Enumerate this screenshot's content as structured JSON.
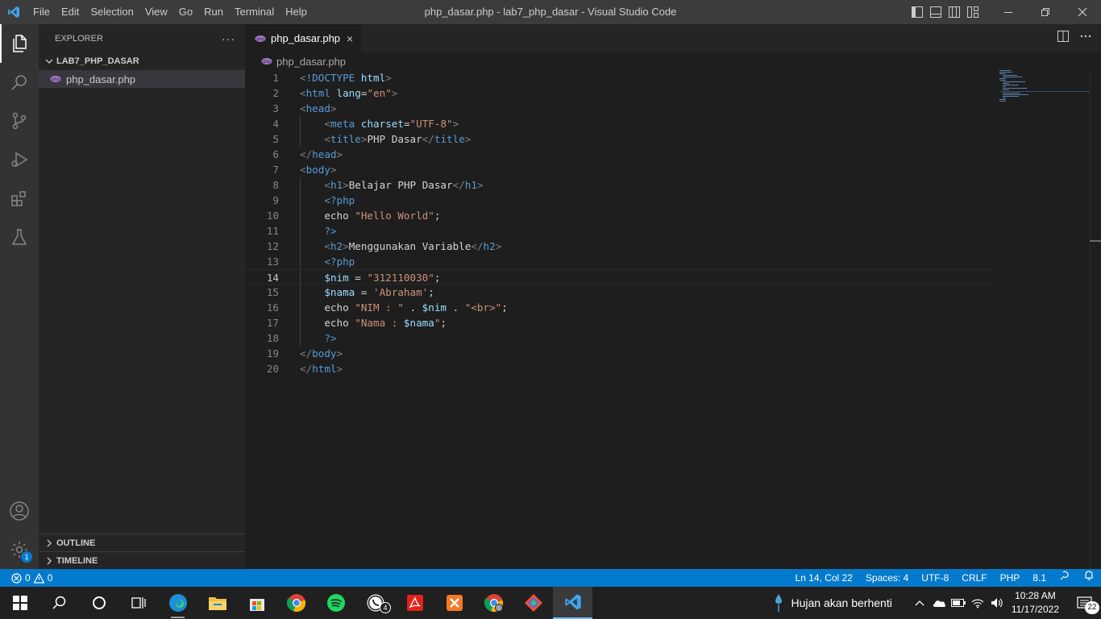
{
  "app": {
    "window_title": "php_dasar.php - lab7_php_dasar - Visual Studio Code",
    "menu": [
      "File",
      "Edit",
      "Selection",
      "View",
      "Go",
      "Run",
      "Terminal",
      "Help"
    ]
  },
  "sidebar": {
    "header": "EXPLORER",
    "more": "···",
    "folder": "LAB7_PHP_DASAR",
    "files": [
      "php_dasar.php"
    ],
    "sections": [
      "OUTLINE",
      "TIMELINE"
    ]
  },
  "activity_bar": {
    "icons": [
      "explorer-icon",
      "search-icon",
      "source-control-icon",
      "run-debug-icon",
      "extensions-icon",
      "testing-icon",
      "account-icon",
      "settings-gear-icon"
    ],
    "settings_badge": "1"
  },
  "editor": {
    "tab": {
      "label": "php_dasar.php",
      "close": "×"
    },
    "breadcrumb": "php_dasar.php",
    "current_line": 14,
    "lines": [
      [
        [
          "t-br",
          "<"
        ],
        [
          "t-tag",
          "!DOCTYPE "
        ],
        [
          "t-attr",
          "html"
        ],
        [
          "t-br",
          ">"
        ]
      ],
      [
        [
          "t-br",
          "<"
        ],
        [
          "t-tag",
          "html "
        ],
        [
          "t-attr",
          "lang"
        ],
        [
          "t-txt",
          "="
        ],
        [
          "t-str",
          "\"en\""
        ],
        [
          "t-br",
          ">"
        ]
      ],
      [
        [
          "t-br",
          "<"
        ],
        [
          "t-tag",
          "head"
        ],
        [
          "t-br",
          ">"
        ]
      ],
      [
        [
          "t-txt",
          "    "
        ],
        [
          "t-br",
          "<"
        ],
        [
          "t-tag",
          "meta "
        ],
        [
          "t-attr",
          "charset"
        ],
        [
          "t-txt",
          "="
        ],
        [
          "t-str",
          "\"UTF-8\""
        ],
        [
          "t-br",
          ">"
        ]
      ],
      [
        [
          "t-txt",
          "    "
        ],
        [
          "t-br",
          "<"
        ],
        [
          "t-tag",
          "title"
        ],
        [
          "t-br",
          ">"
        ],
        [
          "t-txt",
          "PHP Dasar"
        ],
        [
          "t-br",
          "</"
        ],
        [
          "t-tag",
          "title"
        ],
        [
          "t-br",
          ">"
        ]
      ],
      [
        [
          "t-br",
          "</"
        ],
        [
          "t-tag",
          "head"
        ],
        [
          "t-br",
          ">"
        ]
      ],
      [
        [
          "t-br",
          "<"
        ],
        [
          "t-tag",
          "body"
        ],
        [
          "t-br",
          ">"
        ]
      ],
      [
        [
          "t-txt",
          "    "
        ],
        [
          "t-br",
          "<"
        ],
        [
          "t-tag",
          "h1"
        ],
        [
          "t-br",
          ">"
        ],
        [
          "t-txt",
          "Belajar PHP Dasar"
        ],
        [
          "t-br",
          "</"
        ],
        [
          "t-tag",
          "h1"
        ],
        [
          "t-br",
          ">"
        ]
      ],
      [
        [
          "t-txt",
          "    "
        ],
        [
          "t-tag",
          "<?php"
        ]
      ],
      [
        [
          "t-txt",
          "    echo "
        ],
        [
          "t-str",
          "\"Hello World\""
        ],
        [
          "t-txt",
          ";"
        ]
      ],
      [
        [
          "t-txt",
          "    "
        ],
        [
          "t-tag",
          "?>"
        ]
      ],
      [
        [
          "t-txt",
          "    "
        ],
        [
          "t-br",
          "<"
        ],
        [
          "t-tag",
          "h2"
        ],
        [
          "t-br",
          ">"
        ],
        [
          "t-txt",
          "Menggunakan Variable"
        ],
        [
          "t-br",
          "</"
        ],
        [
          "t-tag",
          "h2"
        ],
        [
          "t-br",
          ">"
        ]
      ],
      [
        [
          "t-txt",
          "    "
        ],
        [
          "t-tag",
          "<?php"
        ]
      ],
      [
        [
          "t-txt",
          "    "
        ],
        [
          "t-var",
          "$nim"
        ],
        [
          "t-txt",
          " = "
        ],
        [
          "t-str",
          "\"312110030\""
        ],
        [
          "t-txt",
          ";"
        ]
      ],
      [
        [
          "t-txt",
          "    "
        ],
        [
          "t-var",
          "$nama"
        ],
        [
          "t-txt",
          " = "
        ],
        [
          "t-str",
          "'Abraham'"
        ],
        [
          "t-txt",
          ";"
        ]
      ],
      [
        [
          "t-txt",
          "    echo "
        ],
        [
          "t-str",
          "\"NIM : \""
        ],
        [
          "t-txt",
          " . "
        ],
        [
          "t-var",
          "$nim"
        ],
        [
          "t-txt",
          " . "
        ],
        [
          "t-str",
          "\"<br>\""
        ],
        [
          "t-txt",
          ";"
        ]
      ],
      [
        [
          "t-txt",
          "    echo "
        ],
        [
          "t-str",
          "\"Nama : "
        ],
        [
          "t-var",
          "$nama"
        ],
        [
          "t-str",
          "\""
        ],
        [
          "t-txt",
          ";"
        ]
      ],
      [
        [
          "t-txt",
          "    "
        ],
        [
          "t-tag",
          "?>"
        ]
      ],
      [
        [
          "t-br",
          "</"
        ],
        [
          "t-tag",
          "body"
        ],
        [
          "t-br",
          ">"
        ]
      ],
      [
        [
          "t-br",
          "</"
        ],
        [
          "t-tag",
          "html"
        ],
        [
          "t-br",
          ">"
        ]
      ]
    ]
  },
  "statusbar": {
    "errors": "0",
    "warnings": "0",
    "position": "Ln 14, Col 22",
    "spaces": "Spaces: 4",
    "encoding": "UTF-8",
    "eol": "CRLF",
    "language": "PHP",
    "version": "8.1"
  },
  "taskbar": {
    "apps": [
      "windows-start-icon",
      "search-icon",
      "cortana-icon",
      "task-view-icon",
      "edge-icon",
      "file-explorer-icon",
      "store-icon",
      "chrome-icon",
      "spotify-icon",
      "whatsapp-icon",
      "acrobat-icon",
      "xampp-icon",
      "chrome-profile-icon",
      "git-icon",
      "vscode-icon"
    ],
    "whatsapp_badge": "4",
    "weather": "Hujan akan berhenti",
    "time": "10:28 AM",
    "date": "11/17/2022",
    "notifications": "22"
  },
  "colors": {
    "accent": "#007acc",
    "titlebar": "#3c3c3c",
    "activitybar": "#333333",
    "sidebar": "#252526",
    "editor": "#1e1e1e",
    "taskbar": "#202020"
  }
}
